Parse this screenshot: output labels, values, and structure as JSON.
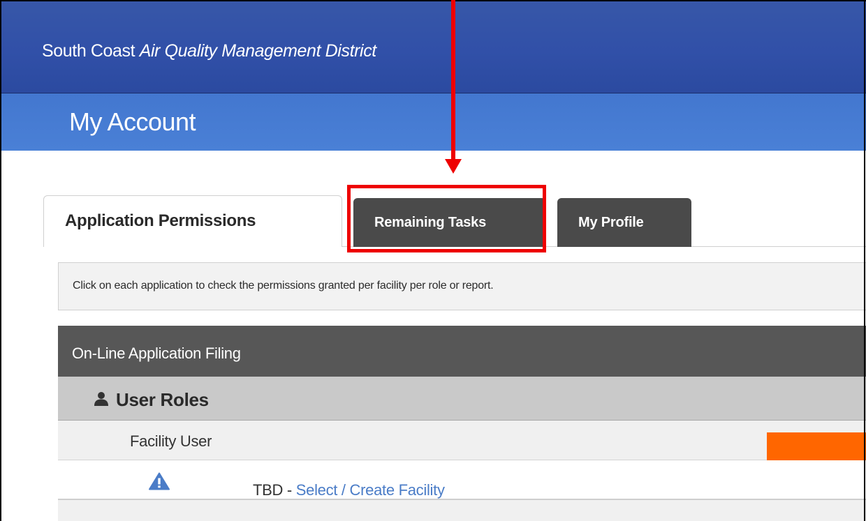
{
  "header": {
    "brand_prefix": "South Coast ",
    "brand_italic": "Air Quality Management District"
  },
  "page": {
    "title": "My Account"
  },
  "tabs": [
    {
      "label": "Application Permissions",
      "active": true
    },
    {
      "label": "Remaining Tasks",
      "active": false,
      "highlighted": true
    },
    {
      "label": "My Profile",
      "active": false
    }
  ],
  "info": {
    "text": "Click on each application to check the permissions granted per facility per role or report."
  },
  "panel": {
    "title": "On-Line Application Filing",
    "roles_heading": "User Roles",
    "roles_icon": "user-icon",
    "role_name": "Facility User",
    "row": {
      "icon": "warning-icon",
      "prefix": "TBD - ",
      "link": "Select / Create Facility"
    }
  },
  "colors": {
    "header": "#3150a8",
    "titlebar": "#4a80d6",
    "tab_dark": "#4a4a4a",
    "panel_head": "#575757",
    "annotation_red": "#ee0000",
    "link": "#4a7cc7",
    "orange_block": "#ff6600"
  }
}
